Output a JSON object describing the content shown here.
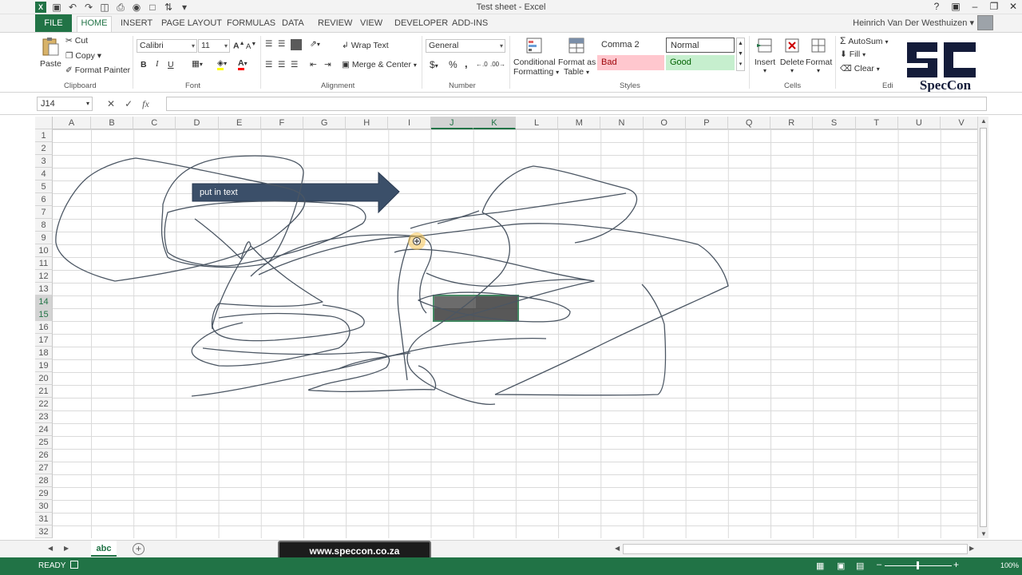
{
  "window": {
    "title": "Test sheet - Excel",
    "user": "Heinrich Van Der Westhuizen"
  },
  "tabs": [
    "FILE",
    "HOME",
    "INSERT",
    "PAGE LAYOUT",
    "FORMULAS",
    "DATA",
    "REVIEW",
    "VIEW",
    "DEVELOPER",
    "ADD-INS"
  ],
  "ribbon": {
    "clipboard": {
      "paste": "Paste",
      "cut": "Cut",
      "copy": "Copy",
      "format_painter": "Format Painter",
      "label": "Clipboard"
    },
    "font": {
      "name": "Calibri",
      "size": "11",
      "bold": "B",
      "italic": "I",
      "underline": "U",
      "label": "Font"
    },
    "alignment": {
      "wrap_text": "Wrap Text",
      "merge_center": "Merge & Center",
      "label": "Alignment"
    },
    "number": {
      "format": "General",
      "currency": "$",
      "percent": "%",
      "comma": ",",
      "label": "Number"
    },
    "styles": {
      "conditional_formatting": [
        "Conditional",
        "Formatting"
      ],
      "format_as_table": [
        "Format as",
        "Table"
      ],
      "cells": [
        "Comma 2",
        "Normal",
        "Bad",
        "Good"
      ],
      "label": "Styles"
    },
    "cells": {
      "insert": "Insert",
      "delete": "Delete",
      "format": "Format",
      "label": "Cells"
    },
    "editing": {
      "autosum": "AutoSum",
      "fill": "Fill",
      "clear": "Clear",
      "label": "Edi"
    },
    "logo_text": "SpecCon"
  },
  "formula_bar": {
    "name_box": "J14",
    "cancel": "✕",
    "enter": "✓",
    "fx": "fx",
    "value": ""
  },
  "grid": {
    "columns": [
      "A",
      "B",
      "C",
      "D",
      "E",
      "F",
      "G",
      "H",
      "I",
      "J",
      "K",
      "L",
      "M",
      "N",
      "O",
      "P",
      "Q",
      "R",
      "S",
      "T",
      "U",
      "V"
    ],
    "selected_columns": [
      "J",
      "K"
    ],
    "rows": [
      "1",
      "2",
      "3",
      "4",
      "5",
      "6",
      "7",
      "8",
      "9",
      "10",
      "11",
      "12",
      "13",
      "14",
      "15",
      "16",
      "17",
      "18",
      "19",
      "20",
      "21",
      "22",
      "23",
      "24",
      "25",
      "26",
      "27",
      "28",
      "29",
      "30",
      "31",
      "32"
    ],
    "selected_rows": [
      "14",
      "15"
    ],
    "arrow_shape_text": "put in text"
  },
  "sheets": {
    "active": "abc",
    "add": "+"
  },
  "watermark": "www.speccon.co.za",
  "status": {
    "ready": "READY",
    "zoom": "100%"
  },
  "colors": {
    "excel_green": "#217346",
    "arrow_fill": "#3b4f69",
    "bad_bg": "#ffc7ce",
    "good_bg": "#c6efce"
  }
}
